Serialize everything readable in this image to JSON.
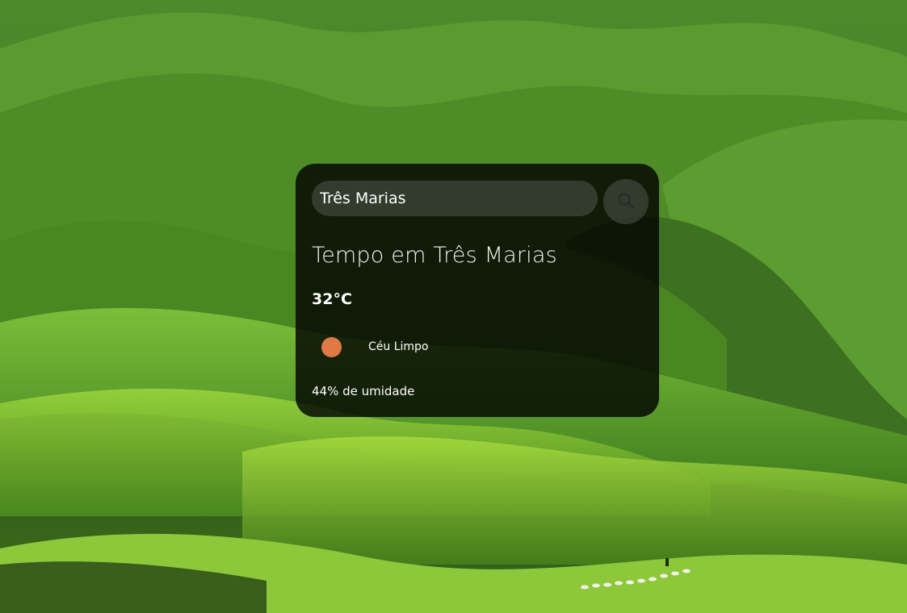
{
  "search": {
    "value": "Três Marias",
    "button_icon": "search-icon"
  },
  "weather": {
    "title": "Tempo em Três Marias",
    "temperature": "32°C",
    "condition": "Céu Limpo",
    "condition_icon": "clear-sky-icon",
    "humidity": "44% de umidade"
  },
  "colors": {
    "card_bg": "#000000",
    "sun": "#e07a45"
  }
}
